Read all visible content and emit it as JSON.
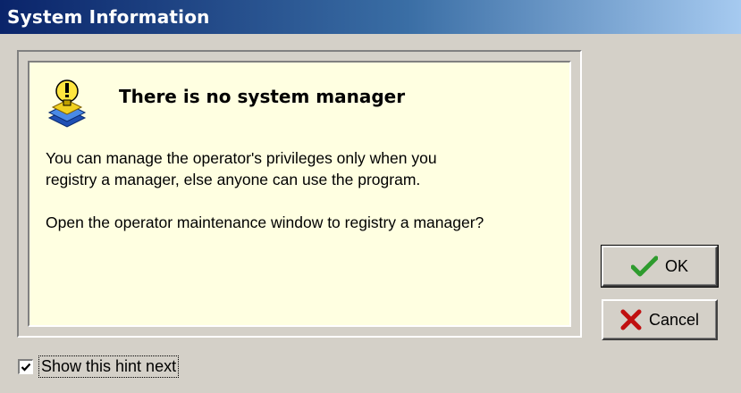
{
  "window": {
    "title": "System Information"
  },
  "message": {
    "icon": "hint-bulb-icon",
    "headline": "There is no system manager",
    "line1": "You can manage the operator's privileges only when you",
    "line2": "registry a manager, else anyone can use the program.",
    "question": "Open the operator maintenance window to registry a manager?",
    "background_color": "#ffffe1"
  },
  "buttons": {
    "ok_label": "OK",
    "ok_icon": "checkmark-icon",
    "cancel_label": "Cancel",
    "cancel_icon": "x-icon"
  },
  "hint_checkbox": {
    "label": "Show this hint next",
    "checked": true
  },
  "colors": {
    "title_gradient_start": "#0a246a",
    "title_gradient_end": "#a6caf0",
    "ok_check": "#2e9b2e",
    "cancel_x": "#c01010"
  }
}
